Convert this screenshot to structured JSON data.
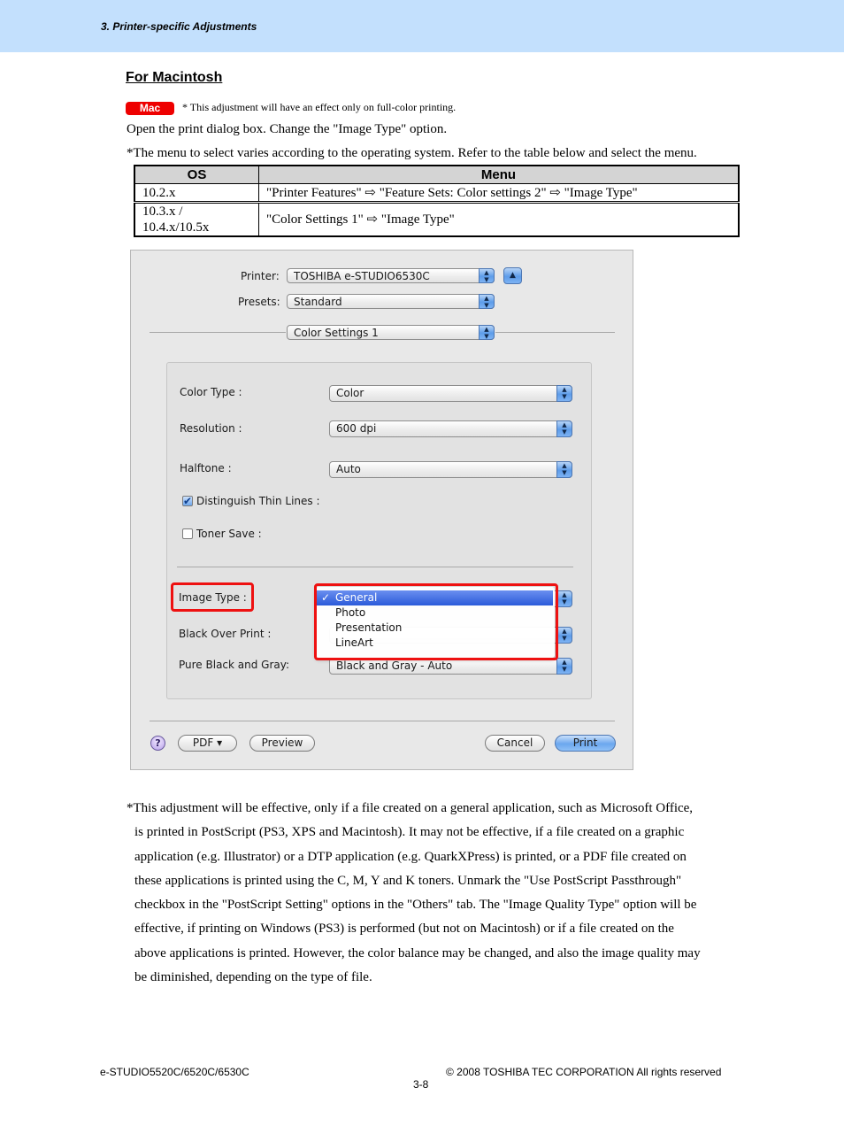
{
  "header": {
    "title": "3. Printer-specific Adjustments",
    "band_color": "#c3e0fd"
  },
  "section": {
    "title": "For Macintosh",
    "badge": {
      "label": "Mac",
      "color": "#ee0000"
    },
    "badge_note": "* This adjustment will have an effect only on full-color printing.",
    "instruction": "Open the print dialog box.  Change the \"Image Type\" option.",
    "table_note": "*The menu to select varies according to the operating system.  Refer to the table below and select the menu."
  },
  "os_table": {
    "headers": [
      "OS",
      "Menu"
    ],
    "rows": [
      [
        "10.2.x",
        "\"Printer Features\" ⇨ \"Feature Sets: Color settings 2\" ⇨ \"Image Type\""
      ],
      [
        "10.3.x / 10.4.x/10.5x",
        "\"Color Settings 1\" ⇨ \"Image Type\""
      ]
    ]
  },
  "dialog": {
    "printer_label": "Printer:",
    "printer_value": "TOSHIBA e-STUDIO6530C",
    "presets_label": "Presets:",
    "presets_value": "Standard",
    "panel_value": "Color Settings 1",
    "color_type_label": "Color Type :",
    "color_type_value": "Color",
    "resolution_label": "Resolution :",
    "resolution_value": "600 dpi",
    "halftone_label": "Halftone :",
    "halftone_value": "Auto",
    "thin_lines_label": "Distinguish Thin Lines :",
    "thin_lines_checked": true,
    "toner_save_label": "Toner Save :",
    "toner_save_checked": false,
    "image_type_label": "Image Type :",
    "black_over_print_label": "Black Over Print :",
    "pure_black_label": "Pure Black and Gray:",
    "pure_black_value": "Black and Gray - Auto",
    "image_type_menu": {
      "check": "✓",
      "items": [
        "General",
        "Photo",
        "Presentation",
        "LineArt"
      ],
      "selected": "General"
    },
    "help_label": "?",
    "pdf_button": "PDF ▾",
    "preview_button": "Preview",
    "cancel_button": "Cancel",
    "print_button": "Print",
    "highlight_color": "#ee1111"
  },
  "body_paragraph": [
    "*This adjustment will be effective, only if a file created on a general application, such as Microsoft Office,",
    "is printed in PostScript (PS3, XPS and Macintosh).  It may not be effective, if a file created on a graphic",
    "application (e.g. Illustrator) or a DTP application (e.g. QuarkXPress) is printed, or a PDF file created on",
    "these applications is printed using the C, M, Y and K toners.  Unmark the \"Use PostScript Passthrough\"",
    "checkbox in the \"PostScript Setting\" options in the \"Others\" tab.  The \"Image Quality Type\" option will be",
    "effective, if printing on Windows (PS3) is performed (but not on Macintosh) or if a file created on the",
    "above applications is printed.  However, the color balance may be changed, and also the image quality may",
    "be diminished, depending on the type of file."
  ],
  "footer": {
    "model": "e-STUDIO5520C/6520C/6530C",
    "copyright": "© 2008 TOSHIBA TEC CORPORATION All rights reserved",
    "page": "3-8"
  }
}
